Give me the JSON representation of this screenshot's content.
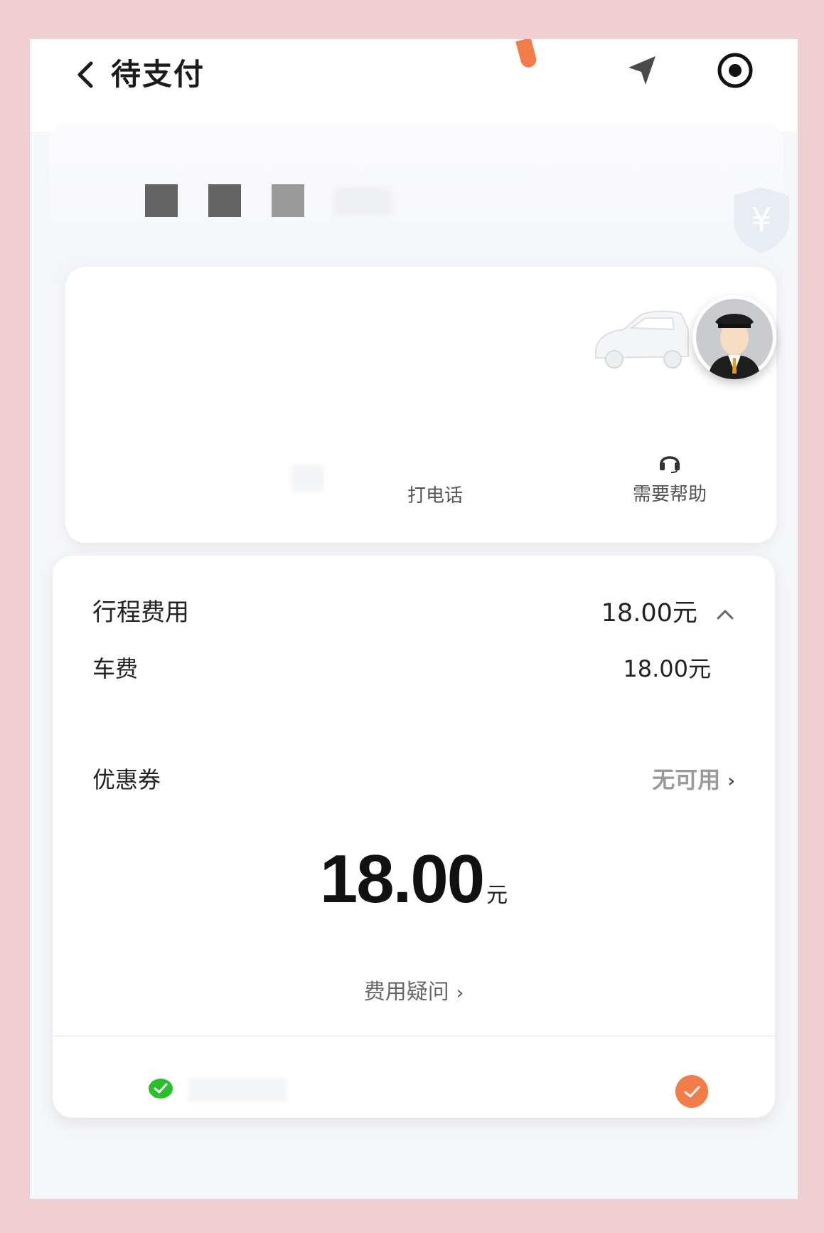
{
  "header": {
    "title": "待支付",
    "back_icon": "chevron-left-icon",
    "navigate_icon": "navigation-arrow-icon",
    "target_icon": "target-icon"
  },
  "vehicle": {
    "shield_icon": "yuan-shield-icon"
  },
  "driver_card": {
    "call_label": "打电话",
    "help_label": "需要帮助",
    "help_icon": "headset-icon"
  },
  "fees": {
    "trip_label": "行程费用",
    "trip_value": "18.00元",
    "car_label": "车费",
    "car_value": "18.00元",
    "coupon_label": "优惠券",
    "coupon_value": "无可用",
    "total_amount": "18.00",
    "total_unit": "元",
    "question_label": "费用疑问",
    "question_chevron": "›",
    "coupon_chevron": "›"
  },
  "payment": {
    "method_icon": "wechat-pay-icon",
    "selected_icon": "check-circle-icon"
  },
  "colors": {
    "accent_orange": "#f27d4a",
    "wechat_green": "#2bbe2b",
    "frame_pink": "#f0cfd3"
  }
}
